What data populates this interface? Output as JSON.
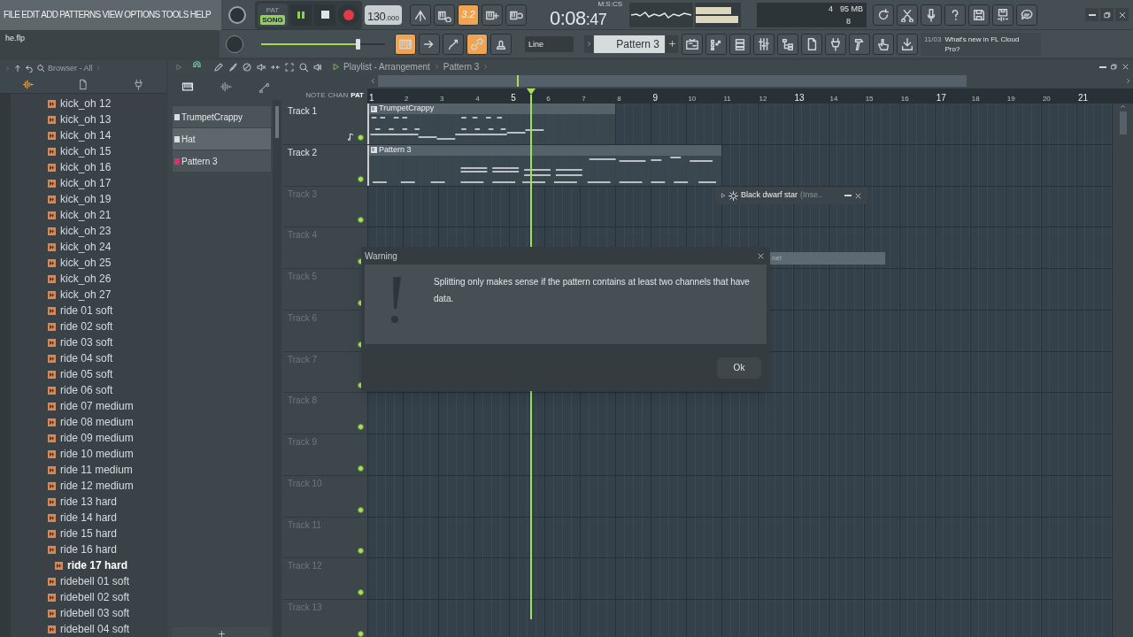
{
  "menu": [
    "FILE",
    "EDIT",
    "ADD",
    "PATTERNS",
    "VIEW",
    "OPTIONS",
    "TOOLS",
    "HELP"
  ],
  "modes": [
    {
      "label": "PAT",
      "selected": false
    },
    {
      "label": "SONG",
      "selected": true
    }
  ],
  "recording": false,
  "tempo": {
    "whole": "130",
    "fraction": ".000"
  },
  "toolbar_top": [
    {
      "on": false
    },
    {
      "on": false
    },
    {
      "label": "3.2",
      "on": true
    },
    {
      "on": false
    },
    {
      "on": false
    }
  ],
  "time": {
    "main": "0:08",
    "sub": ":47",
    "label": "M:S:CS"
  },
  "cpu": {
    "voices": "4",
    "memory": "95 MB",
    "polyphony": "8"
  },
  "file_name": "he.flp",
  "master_volume": {
    "level": 0.78
  },
  "toolbar_tools": [
    {
      "on": true
    },
    {
      "on": false
    },
    {
      "on": false
    },
    {
      "on": true
    },
    {
      "on": false
    }
  ],
  "snap": "Line",
  "pattern_selector": "Pattern 3",
  "news": {
    "date": "11/03",
    "text": "What's new in FL Cloud Pro?"
  },
  "browser": {
    "title": "Browser - All",
    "items": [
      {
        "label": "kick_oh 12",
        "selected": false
      },
      {
        "label": "kick_oh 13",
        "selected": false
      },
      {
        "label": "kick_oh 14",
        "selected": false
      },
      {
        "label": "kick_oh 15",
        "selected": false
      },
      {
        "label": "kick_oh 16",
        "selected": false
      },
      {
        "label": "kick_oh 17",
        "selected": false
      },
      {
        "label": "kick_oh 19",
        "selected": false
      },
      {
        "label": "kick_oh 21",
        "selected": false
      },
      {
        "label": "kick_oh 23",
        "selected": false
      },
      {
        "label": "kick_oh 24",
        "selected": false
      },
      {
        "label": "kick_oh 25",
        "selected": false
      },
      {
        "label": "kick_oh 26",
        "selected": false
      },
      {
        "label": "kick_oh 27",
        "selected": false
      },
      {
        "label": "ride 01 soft",
        "selected": false
      },
      {
        "label": "ride 02 soft",
        "selected": false
      },
      {
        "label": "ride 03 soft",
        "selected": false
      },
      {
        "label": "ride 04 soft",
        "selected": false
      },
      {
        "label": "ride 05 soft",
        "selected": false
      },
      {
        "label": "ride 06 soft",
        "selected": false
      },
      {
        "label": "ride 07 medium",
        "selected": false
      },
      {
        "label": "ride 08 medium",
        "selected": false
      },
      {
        "label": "ride 09 medium",
        "selected": false
      },
      {
        "label": "ride 10 medium",
        "selected": false
      },
      {
        "label": "ride 11 medium",
        "selected": false
      },
      {
        "label": "ride 12 medium",
        "selected": false
      },
      {
        "label": "ride 13 hard",
        "selected": false
      },
      {
        "label": "ride 14 hard",
        "selected": false
      },
      {
        "label": "ride 15 hard",
        "selected": false
      },
      {
        "label": "ride 16 hard",
        "selected": false
      },
      {
        "label": "ride 17 hard",
        "selected": true
      },
      {
        "label": "ridebell 01 soft",
        "selected": false
      },
      {
        "label": "ridebell 02 soft",
        "selected": false
      },
      {
        "label": "ridebell 03 soft",
        "selected": false
      },
      {
        "label": "ridebell 04 soft",
        "selected": false
      }
    ]
  },
  "playlist": {
    "title": "Playlist - Arrangement",
    "crumb": "Pattern 3",
    "picker_tabs": [
      {
        "label": "NOTE",
        "selected": false
      },
      {
        "label": "CHAN",
        "selected": false
      },
      {
        "label": "PAT",
        "selected": true
      }
    ],
    "patterns": [
      {
        "label": "TrumpetCrappy",
        "selected": false,
        "color": "#d8dde0"
      },
      {
        "label": "Hat",
        "selected": true,
        "color": "#d8dde0"
      },
      {
        "label": "Pattern 3",
        "selected": false,
        "color": "#e0306a"
      }
    ],
    "bars": [
      "1",
      "2",
      "3",
      "4",
      "5",
      "6",
      "7",
      "8",
      "9",
      "10",
      "11",
      "12",
      "13",
      "14",
      "15",
      "16",
      "17",
      "18",
      "19",
      "20",
      "21"
    ],
    "tracks": [
      {
        "label": "Track 1",
        "active": true,
        "clips": [
          {
            "label": "TrumpetCrappy"
          }
        ]
      },
      {
        "label": "Track 2",
        "active": true,
        "clips": [
          {
            "label": "Pattern 3"
          }
        ]
      },
      {
        "label": "Track 3",
        "active": false
      },
      {
        "label": "Track 4",
        "active": false
      },
      {
        "label": "Track 5",
        "active": false
      },
      {
        "label": "Track 6",
        "active": false
      },
      {
        "label": "Track 7",
        "active": false
      },
      {
        "label": "Track 8",
        "active": false
      },
      {
        "label": "Track 9",
        "active": false
      },
      {
        "label": "Track 10",
        "active": false
      },
      {
        "label": "Track 11",
        "active": false
      },
      {
        "label": "Track 12",
        "active": false
      },
      {
        "label": "Track 13",
        "active": false
      }
    ]
  },
  "plugin_window": {
    "title": "Black dwarf star",
    "suffix": "(Inse.."
  },
  "hidden_bar": {
    "text": "nel"
  },
  "dialog": {
    "title": "Warning",
    "message": "Splitting only makes sense if the pattern contains at least two channels that have data.",
    "button": "Ok"
  }
}
